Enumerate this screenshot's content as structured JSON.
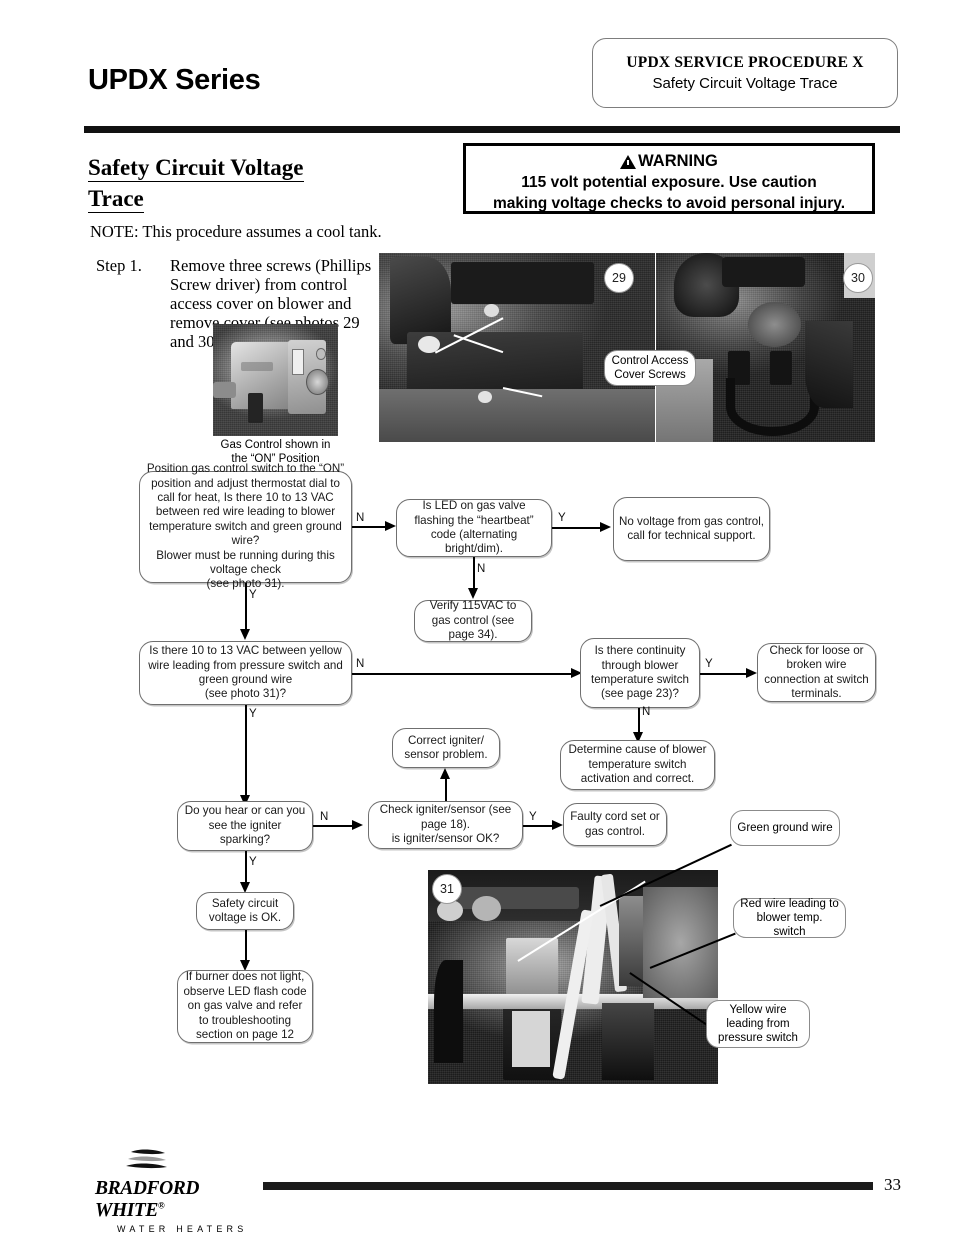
{
  "header": {
    "series_title": "UPDX Series",
    "procedure_line1": "UPDX SERVICE PROCEDURE  X",
    "procedure_line2": "Safety Circuit Voltage Trace"
  },
  "section": {
    "title_line1": "Safety Circuit Voltage",
    "title_line2": "Trace",
    "note": "NOTE: This procedure assumes a cool tank."
  },
  "warning": {
    "heading": "WARNING",
    "line1": "115 volt potential exposure. Use caution",
    "line2": "making voltage checks to avoid personal injury."
  },
  "step": {
    "label": "Step 1.",
    "text": "Remove three screws (Phillips Screw driver) from control access cover on blower and remove cover (see photos 29 and 30)."
  },
  "photos": {
    "gas_control": {
      "caption_line1": "Gas Control shown in",
      "caption_line2": "the “ON” Position"
    },
    "photo29": {
      "number": "29"
    },
    "photo30": {
      "number": "30"
    },
    "photo31": {
      "number": "31"
    },
    "callouts": {
      "control_access_line1": "Control Access",
      "control_access_line2": "Cover Screws",
      "green_ground": "Green ground wire",
      "red_wire_line1": "Red wire leading to",
      "red_wire_line2": "blower temp. switch",
      "yellow_wire_line1": "Yellow wire",
      "yellow_wire_line2": "leading from",
      "yellow_wire_line3": "pressure switch"
    }
  },
  "flowchart": {
    "boxes": {
      "b1": "Position gas control switch to the “ON” position and adjust thermostat dial to call for heat, Is there 10 to 13 VAC  between red wire leading to blower temperature switch and green ground wire?\nBlower must be running during this voltage check\n(see photo 31).",
      "b2": "Is LED on gas valve flashing the “heartbeat” code (alternating bright/dim).",
      "b3": "No voltage from gas control, call for technical support.",
      "b4": "Verify 115VAC to gas control (see page 34).",
      "b5": "Is there 10 to 13 VAC  between yellow wire leading from pressure switch and green ground wire\n(see photo 31)?",
      "b6": "Is there continuity through blower temperature switch (see page 23)?",
      "b7": "Check for loose or broken wire connection at switch terminals.",
      "b8": "Determine cause of blower temperature switch activation and correct.",
      "b9": "Correct igniter/\nsensor problem.",
      "b10": "Do you hear or can you see the igniter sparking?",
      "b11": "Check igniter/sensor (see page 18).\nis igniter/sensor OK?",
      "b12": "Faulty cord set or gas control.",
      "b13": "Safety circuit voltage is OK.",
      "b14": "If burner does not light, observe LED flash code on gas valve and refer to troubleshooting section on page 12"
    },
    "labels": {
      "n1": "N",
      "y1": "Y",
      "n2": "N",
      "y2": "Y",
      "n3": "N",
      "y3": "Y",
      "n4": "N",
      "y4": "Y",
      "n5": "N",
      "y5": "Y"
    }
  },
  "footer": {
    "logo_name": "BRADFORD WHITE",
    "logo_registered": "®",
    "logo_sub": "WATER HEATERS",
    "page_number": "33"
  }
}
